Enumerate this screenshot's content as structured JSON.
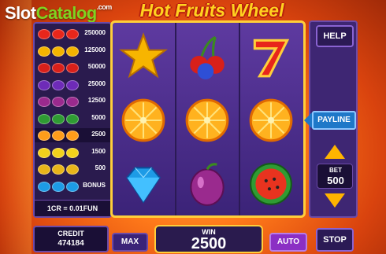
{
  "logo": {
    "part1": "Slot",
    "part2": "Catalog",
    "part3": ".com"
  },
  "title": "Hot Fruits Wheel",
  "paytable": {
    "rows": [
      {
        "symbol": "seven-icon",
        "value": "250000",
        "color": "#e8261b"
      },
      {
        "symbol": "star-icon",
        "value": "125000",
        "color": "#f4b400"
      },
      {
        "symbol": "cherries-icon",
        "value": "50000",
        "color": "#d8201a"
      },
      {
        "symbol": "grapes-icon",
        "value": "25000",
        "color": "#6e2bb8"
      },
      {
        "symbol": "plum-icon",
        "value": "12500",
        "color": "#9a2a8e"
      },
      {
        "symbol": "watermelon-icon",
        "value": "5000",
        "color": "#2f9b33"
      },
      {
        "symbol": "orange-icon",
        "value": "2500",
        "color": "#ff9d1a"
      },
      {
        "symbol": "lemon-icon",
        "value": "1500",
        "color": "#f2d21c"
      },
      {
        "symbol": "bell-icon",
        "value": "500",
        "color": "#e8b51a"
      },
      {
        "symbol": "diamond-icon",
        "value": "BONUS",
        "color": "#1d9be6"
      }
    ],
    "highlight_row": 6,
    "conversion": "1CR = 0.01FUN"
  },
  "reels": [
    [
      "star-icon",
      "orange-icon",
      "diamond-icon"
    ],
    [
      "cherries-icon",
      "orange-icon",
      "plum-icon"
    ],
    [
      "seven-icon",
      "orange-icon",
      "watermelon-icon"
    ]
  ],
  "buttons": {
    "help": "HELP",
    "payline": "PAYLINE",
    "max": "MAX",
    "auto": "AUTO",
    "stop": "STOP"
  },
  "bet": {
    "label": "BET",
    "value": "500"
  },
  "credit": {
    "label": "CREDIT",
    "value": "474184"
  },
  "win": {
    "label": "WIN",
    "value": "2500"
  },
  "colors": {
    "accent": "#ffcf3a",
    "panel": "#3b2378",
    "payline": "#1e78c8",
    "auto": "#8b2fc4"
  }
}
